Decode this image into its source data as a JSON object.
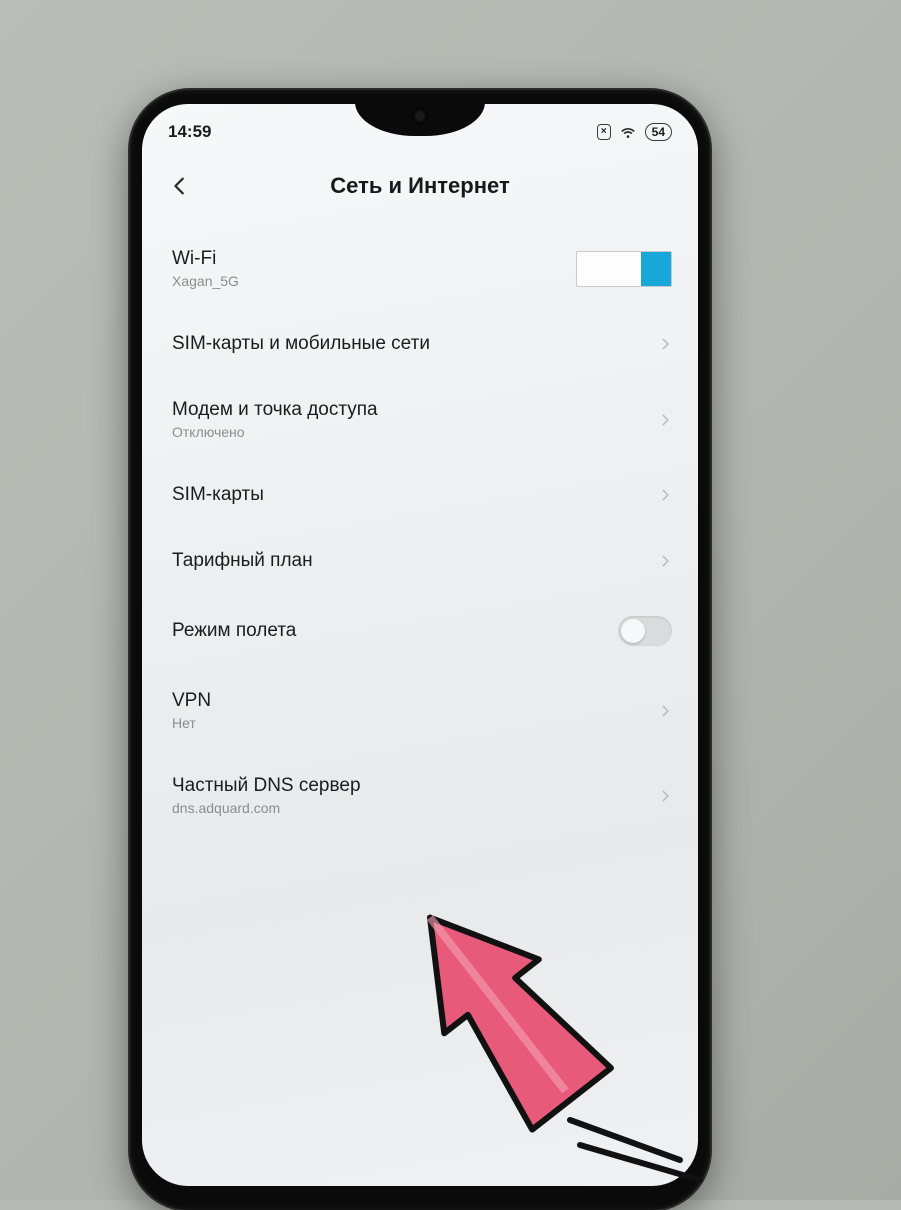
{
  "statusbar": {
    "time": "14:59",
    "battery": "54",
    "sim_indicator": "×"
  },
  "header": {
    "title": "Сеть и Интернет"
  },
  "rows": {
    "wifi": {
      "label": "Wi-Fi",
      "sub": "Xagan_5G"
    },
    "sim_mobile": {
      "label": "SIM-карты и мобильные сети"
    },
    "hotspot": {
      "label": "Модем и точка доступа",
      "sub": "Отключено"
    },
    "sim": {
      "label": "SIM-карты"
    },
    "tariff": {
      "label": "Тарифный план"
    },
    "airplane": {
      "label": "Режим полета"
    },
    "vpn": {
      "label": "VPN",
      "sub": "Нет"
    },
    "dns": {
      "label": "Частный DNS сервер",
      "sub": "dns.adquard.com"
    }
  },
  "annotation": {
    "arrow_color": "#e85a7a"
  }
}
